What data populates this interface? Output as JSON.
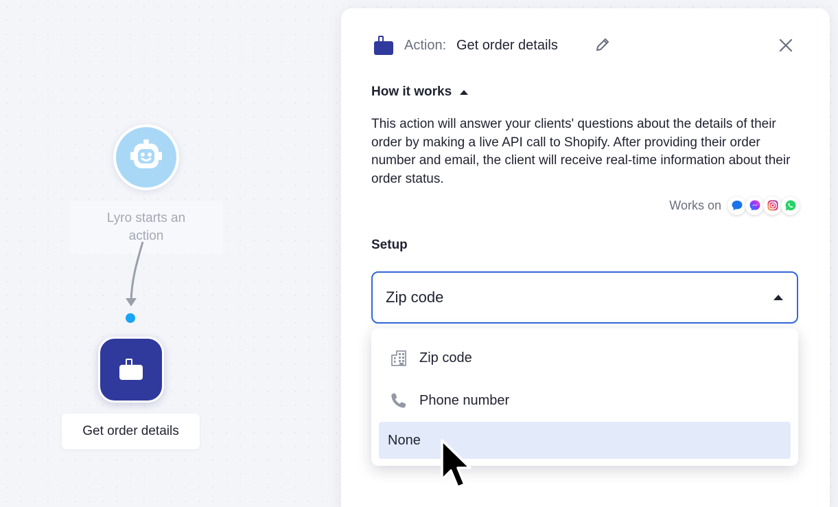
{
  "canvas": {
    "start_node": {
      "label": "Lyro starts an action",
      "icon": "robot-icon"
    },
    "action_node": {
      "label": "Get order details",
      "icon": "briefcase-icon"
    }
  },
  "panel": {
    "header": {
      "prefix": "Action:",
      "title": "Get order details",
      "edit_icon": "pencil-icon",
      "close_icon": "close-icon"
    },
    "how_it_works": {
      "label": "How it works",
      "description": "This action will answer your clients' questions about the details of their order by making a live API call to Shopify. After providing their order number and email, the client will receive real-time information about their order status."
    },
    "works_on": {
      "label": "Works on",
      "channels": [
        "live-chat-icon",
        "messenger-icon",
        "instagram-icon",
        "whatsapp-icon"
      ]
    },
    "setup": {
      "label": "Setup",
      "selected": "Zip code",
      "options": [
        {
          "label": "Zip code",
          "icon": "building-icon"
        },
        {
          "label": "Phone number",
          "icon": "phone-icon"
        },
        {
          "label": "None",
          "icon": ""
        }
      ],
      "hovered_option": "None"
    }
  },
  "colors": {
    "accent_blue": "#3466d8",
    "action_node": "#30399c",
    "bot_node": "#a9d8f7",
    "handle": "#19a4f5",
    "option_hover": "#e3ebfb"
  }
}
